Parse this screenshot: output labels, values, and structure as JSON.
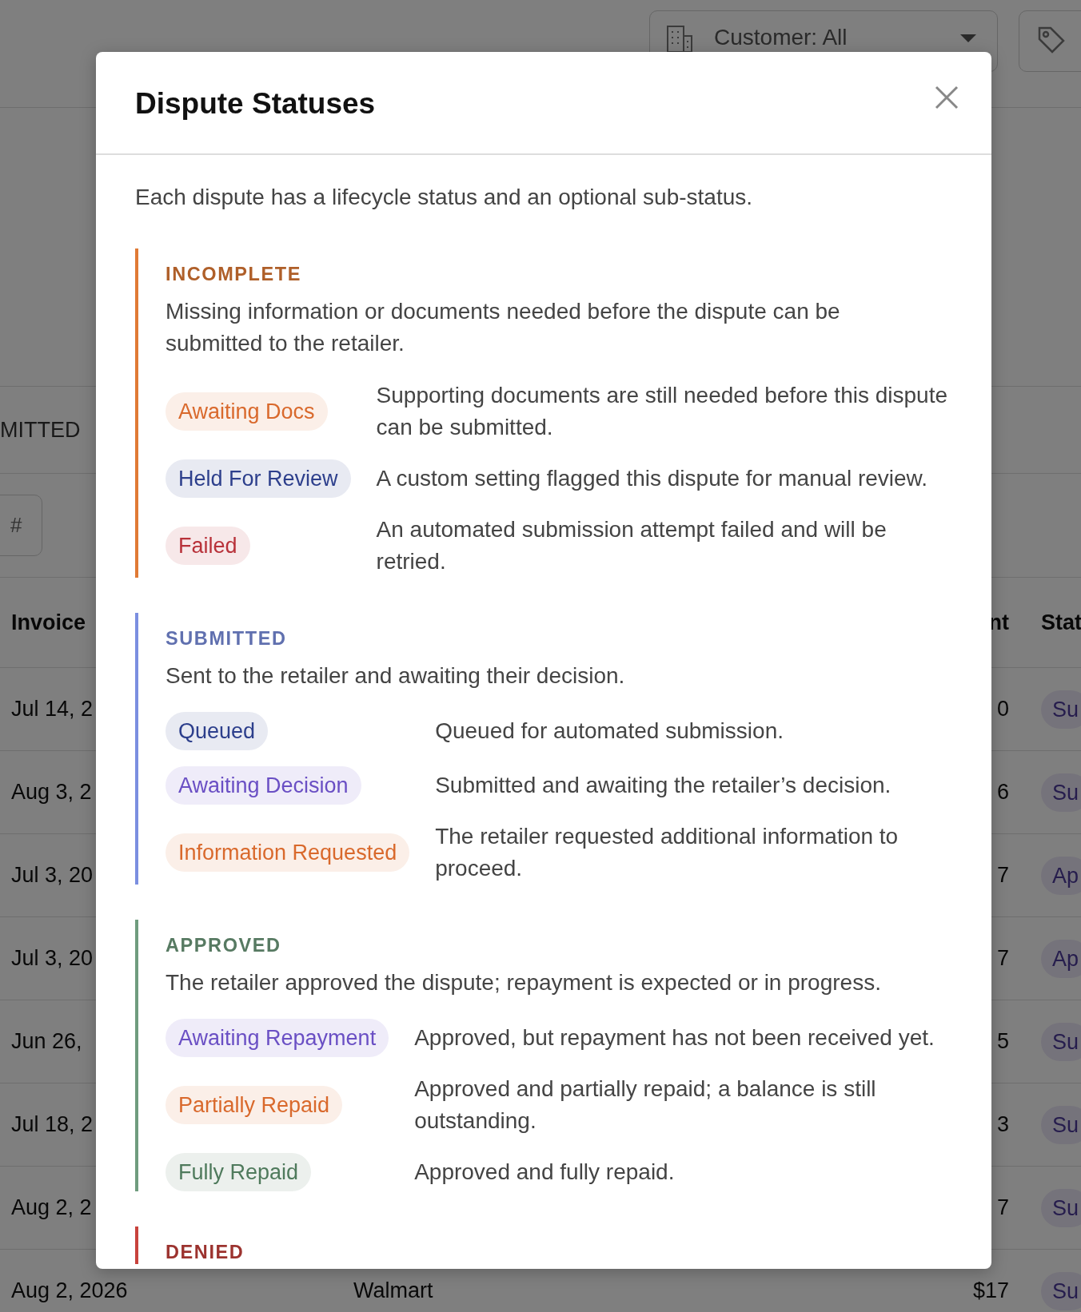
{
  "backdrop": {
    "customer_filter": "Customer: All",
    "tab_label": "MITTED",
    "search_label": "#",
    "table": {
      "columns": [
        "Invoice",
        "nt",
        "Stat"
      ],
      "rows": [
        {
          "date": "Jul 14, 2",
          "amount": "0",
          "status": "Su"
        },
        {
          "date": "Aug 3, 2",
          "amount": "6",
          "status": "Su"
        },
        {
          "date": "Jul 3, 20",
          "amount": "7",
          "status": "Ap"
        },
        {
          "date": "Jul 3, 20",
          "amount": "7",
          "status": "Ap"
        },
        {
          "date": "Jun 26,",
          "amount": "5",
          "status": "Su"
        },
        {
          "date": "Jul 18, 2",
          "amount": "3",
          "status": "Su"
        },
        {
          "date": "Aug 2, 2",
          "amount": "7",
          "status": "Su"
        },
        {
          "date": "Aug 2, 2026",
          "customer": "Walmart",
          "amount": "$17",
          "status": "Su"
        }
      ]
    }
  },
  "modal": {
    "title": "Dispute Statuses",
    "intro": "Each dispute has a lifecycle status and an optional sub-status.",
    "sections": [
      {
        "name": "INCOMPLETE",
        "color": "#e07a35",
        "description": "Missing information or documents needed before the dispute can be submitted to the retailer.",
        "statuses": [
          {
            "label": "Awaiting Docs",
            "color": "#d9692c",
            "description": "Supporting documents are still needed before this dispute can be submitted."
          },
          {
            "label": "Held For Review",
            "color": "#2d3f8c",
            "description": "A custom setting flagged this dispute for manual review."
          },
          {
            "label": "Failed",
            "color": "#b8323a",
            "description": "An automated submission attempt failed and will be retried."
          }
        ]
      },
      {
        "name": "SUBMITTED",
        "color": "#7b8fe0",
        "description": "Sent to the retailer and awaiting their decision.",
        "statuses": [
          {
            "label": "Queued",
            "color": "#2d3f8c",
            "description": "Queued for automated submission."
          },
          {
            "label": "Awaiting Decision",
            "color": "#6a4fc4",
            "description": "Submitted and awaiting the retailer’s decision."
          },
          {
            "label": "Information Requested",
            "color": "#d9692c",
            "description": "The retailer requested additional information to proceed."
          }
        ]
      },
      {
        "name": "APPROVED",
        "color": "#6f9c7e",
        "description": "The retailer approved the dispute; repayment is expected or in progress.",
        "statuses": [
          {
            "label": "Awaiting Repayment",
            "color": "#6a4fc4",
            "description": "Approved, but repayment has not been received yet."
          },
          {
            "label": "Partially Repaid",
            "color": "#d9692c",
            "description": "Approved and partially repaid; a balance is still outstanding."
          },
          {
            "label": "Fully Repaid",
            "color": "#4f7a5c",
            "description": "Approved and fully repaid."
          }
        ]
      },
      {
        "name": "DENIED",
        "color": "#c8423c"
      }
    ]
  }
}
